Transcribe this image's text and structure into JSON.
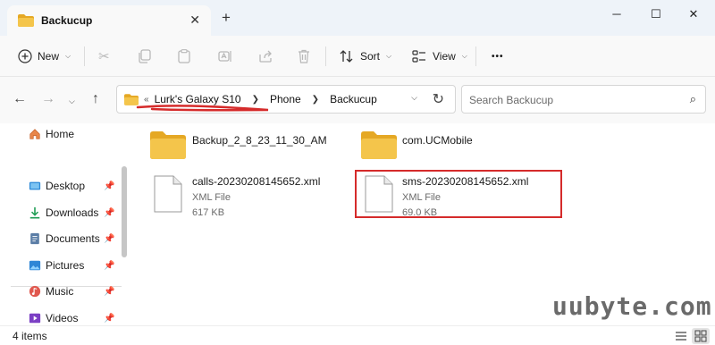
{
  "window": {
    "tab_title": "Backucup",
    "new_tab_glyph": "+",
    "close_tab_glyph": "✕",
    "minimize_glyph": "─",
    "maximize_glyph": "☐",
    "close_glyph": "✕"
  },
  "toolbar": {
    "new_label": "New",
    "sort_label": "Sort",
    "view_label": "View",
    "more_glyph": "•••",
    "icons": [
      "cut-icon",
      "copy-icon",
      "paste-icon",
      "rename-icon",
      "share-icon",
      "delete-icon"
    ]
  },
  "nav": {
    "breadcrumb": [
      "Lurk's Galaxy S10",
      "Phone",
      "Backucup"
    ],
    "overflow_glyph": "«",
    "search_placeholder": "Search Backucup"
  },
  "sidebar": {
    "items": [
      {
        "label": "Home",
        "icon": "home-icon",
        "pinned": false
      },
      {
        "label": "Desktop",
        "icon": "desktop-icon",
        "pinned": true
      },
      {
        "label": "Downloads",
        "icon": "downloads-icon",
        "pinned": true
      },
      {
        "label": "Documents",
        "icon": "documents-icon",
        "pinned": true
      },
      {
        "label": "Pictures",
        "icon": "pictures-icon",
        "pinned": true
      },
      {
        "label": "Music",
        "icon": "music-icon",
        "pinned": true
      },
      {
        "label": "Videos",
        "icon": "videos-icon",
        "pinned": true
      }
    ]
  },
  "files": [
    {
      "name": "Backup_2_8_23_11_30_AM",
      "type": "folder"
    },
    {
      "name": "com.UCMobile",
      "type": "folder"
    },
    {
      "name": "calls-20230208145652.xml",
      "kind": "XML File",
      "size": "617 KB"
    },
    {
      "name": "sms-20230208145652.xml",
      "kind": "XML File",
      "size": "69.0 KB",
      "highlighted": true
    }
  ],
  "status": {
    "item_count": "4 items"
  },
  "watermark": "uubyte.com",
  "colors": {
    "folder": "#f4c54b",
    "folder_dark": "#e5a824",
    "highlight": "#d52b2b",
    "accent": "#1e6fc9",
    "underline": "#d52b2b"
  }
}
